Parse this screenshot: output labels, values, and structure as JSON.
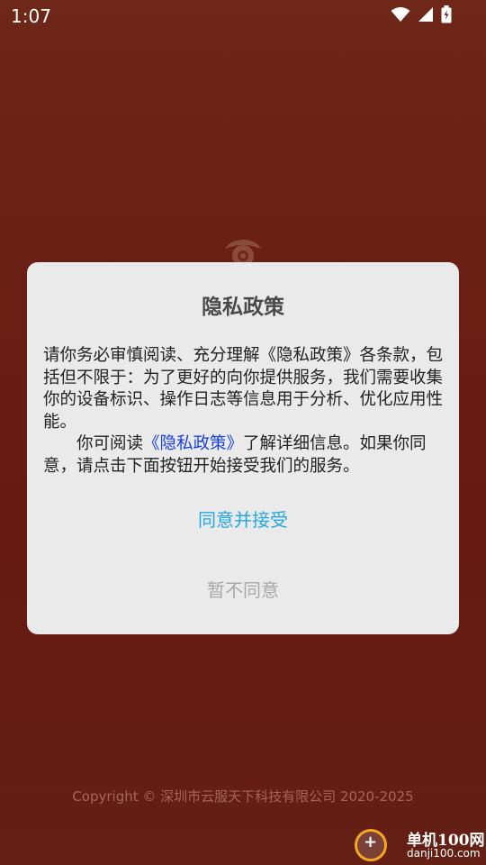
{
  "status_bar": {
    "time": "1:07",
    "icons": [
      "wifi-icon",
      "cellular-signal-icon",
      "battery-charging-icon"
    ]
  },
  "dialog": {
    "title": "隐私政策",
    "paragraph1": "请你务必审慎阅读、充分理解《隐私政策》各条款，包括但不限于：为了更好的向你提供服务，我们需要收集你的设备标识、操作日志等信息用于分析、优化应用性能。",
    "paragraph2_prefix": "你可阅读",
    "policy_link": "《隐私政策》",
    "paragraph2_suffix": "了解详细信息。如果你同意，请点击下面按钮开始接受我们的服务。",
    "agree_label": "同意并接受",
    "decline_label": "暂不同意"
  },
  "footer": {
    "copyright": "Copyright © 深圳市云服天下科技有限公司 2020-2025"
  },
  "watermark": {
    "title": "单机100网",
    "url": "danji100.com"
  },
  "colors": {
    "background": "#6a1e14",
    "dialog_bg": "#eaeaea",
    "agree": "#23a8e0",
    "decline": "#a8a8a8",
    "link": "#1a3fe0"
  }
}
